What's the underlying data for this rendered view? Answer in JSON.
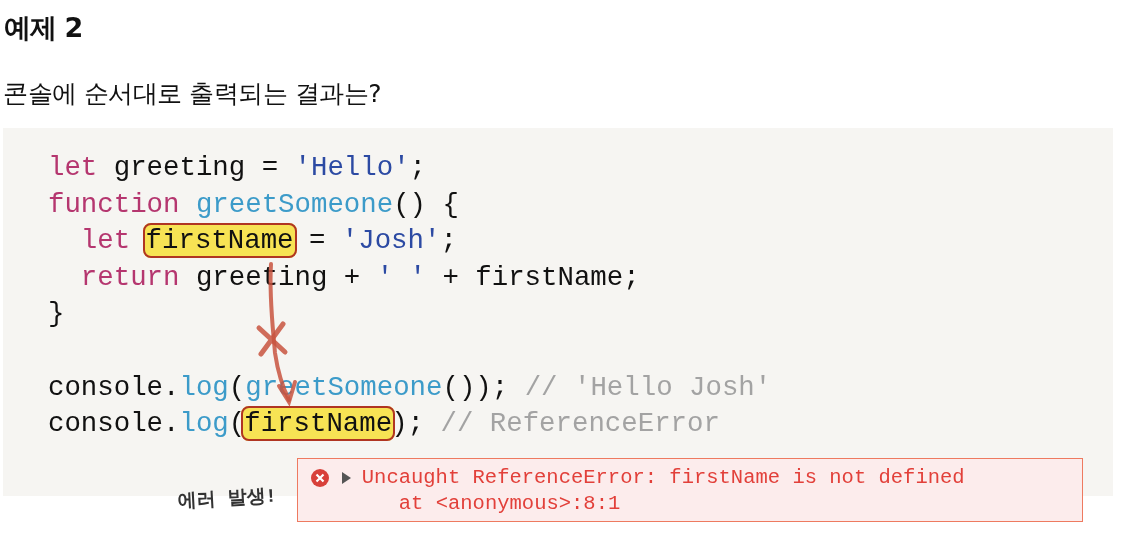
{
  "title": "예제 2",
  "question": "콘솔에 순서대로 출력되는 결과는?",
  "code_lines": [
    {
      "kind": "code",
      "tokens": [
        {
          "kind": "keyword",
          "text": "let"
        },
        {
          "kind": "plain",
          "text": "greeting =",
          "space_before": true
        },
        {
          "kind": "string",
          "text": "'Hello'",
          "space_before": true
        },
        {
          "kind": "plain",
          "text": ";"
        }
      ]
    },
    {
      "kind": "code",
      "tokens": [
        {
          "kind": "keyword",
          "text": "function"
        },
        {
          "kind": "function",
          "text": "greetSomeone",
          "space_before": true
        },
        {
          "kind": "plain",
          "text": "() {"
        }
      ]
    },
    {
      "kind": "code",
      "indented": true,
      "tokens": [
        {
          "kind": "keyword",
          "text": "let"
        },
        {
          "kind": "highlight",
          "text": "firstName",
          "space_before": true
        },
        {
          "kind": "plain",
          "text": "=",
          "space_before": true
        },
        {
          "kind": "string",
          "text": "'Josh'",
          "space_before": true
        },
        {
          "kind": "plain",
          "text": ";"
        }
      ]
    },
    {
      "kind": "code",
      "indented": true,
      "tokens": [
        {
          "kind": "keyword",
          "text": "return"
        },
        {
          "kind": "plain",
          "text": "greeting +",
          "space_before": true
        },
        {
          "kind": "string",
          "text": "' '",
          "space_before": true
        },
        {
          "kind": "plain",
          "text": "+ firstName;",
          "space_before": true
        }
      ]
    },
    {
      "kind": "code",
      "tokens": [
        {
          "kind": "plain",
          "text": "}"
        }
      ]
    },
    {
      "kind": "blank"
    },
    {
      "kind": "code",
      "tokens": [
        {
          "kind": "plain",
          "text": "console."
        },
        {
          "kind": "function",
          "text": "log"
        },
        {
          "kind": "plain",
          "text": "("
        },
        {
          "kind": "function",
          "text": "greetSomeone"
        },
        {
          "kind": "plain",
          "text": "());"
        },
        {
          "kind": "comment",
          "text": "// 'Hello Josh'",
          "space_before": true
        }
      ]
    },
    {
      "kind": "code",
      "tokens": [
        {
          "kind": "plain",
          "text": "console."
        },
        {
          "kind": "function",
          "text": "log"
        },
        {
          "kind": "plain",
          "text": "("
        },
        {
          "kind": "highlight",
          "text": "firstName"
        },
        {
          "kind": "plain",
          "text": ");"
        },
        {
          "kind": "comment",
          "text": "// ReferenceError",
          "space_before": true
        }
      ]
    }
  ],
  "annotation": "에러 발생!",
  "console_error": {
    "message": "Uncaught ReferenceError: firstName is not defined",
    "location": "at <anonymous>:8:1"
  }
}
